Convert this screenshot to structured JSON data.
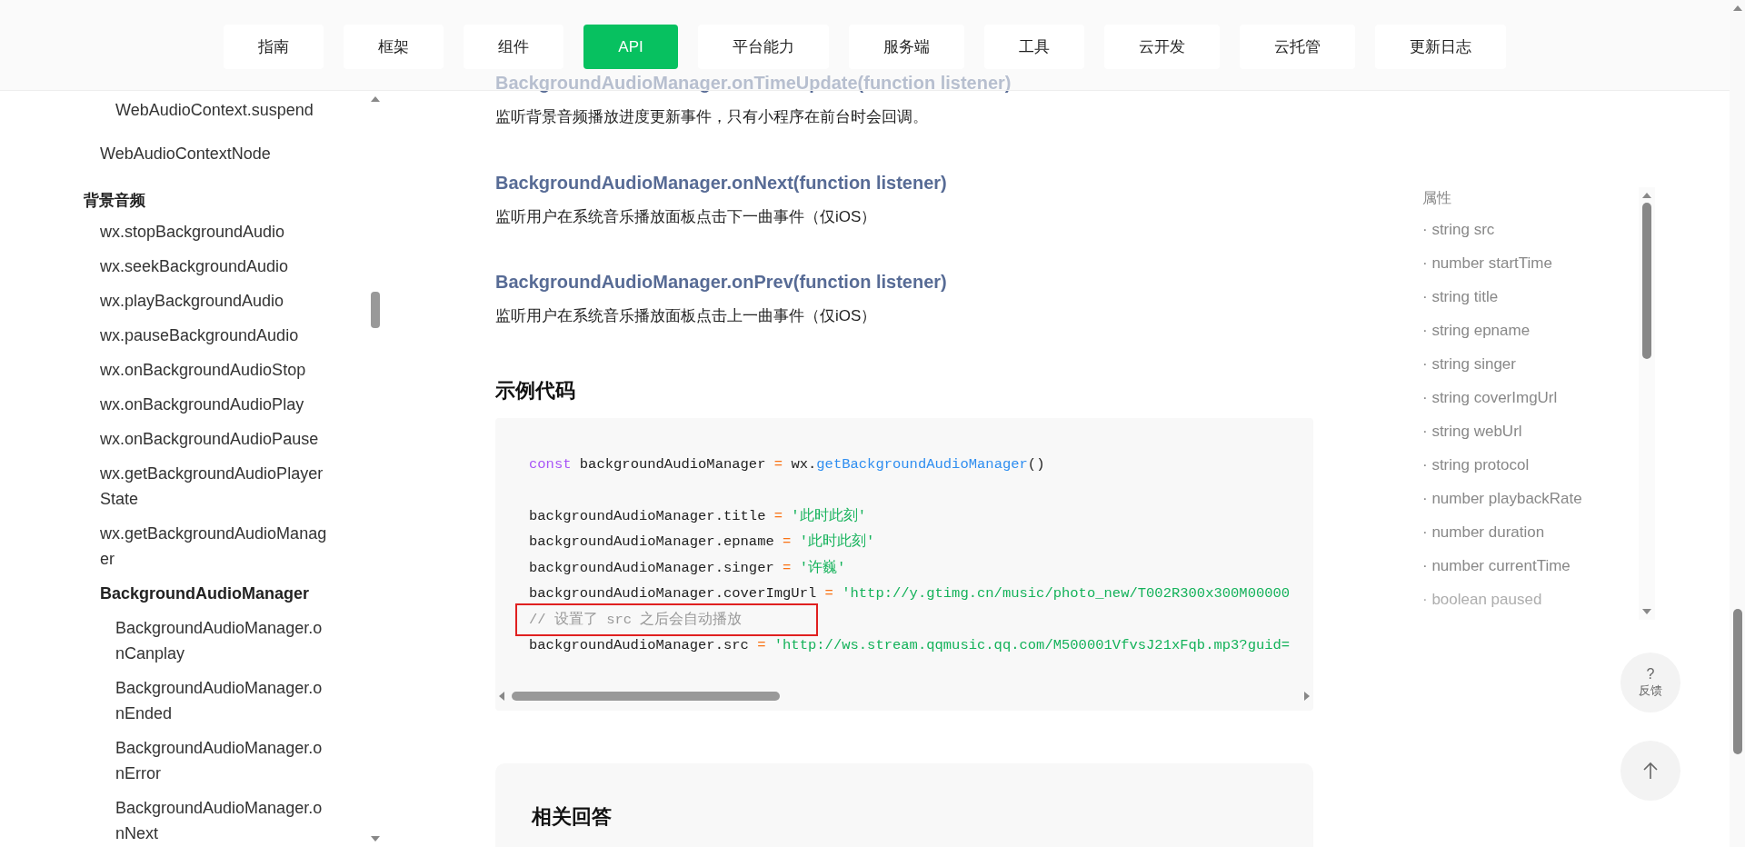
{
  "nav": {
    "tabs": [
      {
        "label": "指南",
        "selected": false
      },
      {
        "label": "框架",
        "selected": false
      },
      {
        "label": "组件",
        "selected": false
      },
      {
        "label": "API",
        "selected": true
      },
      {
        "label": "平台能力",
        "selected": false
      },
      {
        "label": "服务端",
        "selected": false
      },
      {
        "label": "工具",
        "selected": false
      },
      {
        "label": "云开发",
        "selected": false
      },
      {
        "label": "云托管",
        "selected": false
      },
      {
        "label": "更新日志",
        "selected": false
      }
    ]
  },
  "sidebar": {
    "sections": [
      {
        "items": [
          {
            "children": [
              {
                "label": "WebAudioContext.suspend"
              }
            ]
          },
          {
            "label": "WebAudioContextNode"
          }
        ]
      },
      {
        "title": "背景音频",
        "items": [
          {
            "label": "wx.stopBackgroundAudio"
          },
          {
            "label": "wx.seekBackgroundAudio"
          },
          {
            "label": "wx.playBackgroundAudio"
          },
          {
            "label": "wx.pauseBackgroundAudio"
          },
          {
            "label": "wx.onBackgroundAudioStop"
          },
          {
            "label": "wx.onBackgroundAudioPlay"
          },
          {
            "label": "wx.onBackgroundAudioPause"
          },
          {
            "label": "wx.getBackgroundAudioPlayerState"
          },
          {
            "label": "wx.getBackgroundAudioManager"
          },
          {
            "label": "BackgroundAudioManager",
            "children": [
              {
                "label": "BackgroundAudioManager.onCanplay"
              },
              {
                "label": "BackgroundAudioManager.onEnded"
              },
              {
                "label": "BackgroundAudioManager.onError"
              },
              {
                "label": "BackgroundAudioManager.onNext"
              }
            ]
          }
        ]
      }
    ]
  },
  "content": {
    "blocks": [
      {
        "kind": "heading",
        "text": "BackgroundAudioManager.onTimeUpdate(function listener)"
      },
      {
        "kind": "paragraph",
        "text": "监听背景音频播放进度更新事件，只有小程序在前台时会回调。"
      },
      {
        "kind": "heading",
        "text": "BackgroundAudioManager.onNext(function listener)"
      },
      {
        "kind": "paragraph",
        "text": "监听用户在系统音乐播放面板点击下一曲事件（仅iOS）"
      },
      {
        "kind": "heading",
        "text": "BackgroundAudioManager.onPrev(function listener)"
      },
      {
        "kind": "paragraph",
        "text": "监听用户在系统音乐播放面板点击上一曲事件（仅iOS）"
      },
      {
        "kind": "section_title",
        "text": "示例代码"
      }
    ],
    "code": [
      {
        "kind": "code",
        "tokens": [
          {
            "kind": "keyword",
            "text": "const"
          },
          {
            "kind": "plain",
            "text": " backgroundAudioManager "
          },
          {
            "kind": "op",
            "text": "="
          },
          {
            "kind": "plain",
            "text": " wx."
          },
          {
            "kind": "func",
            "text": "getBackgroundAudioManager"
          },
          {
            "kind": "plain",
            "text": "()"
          }
        ]
      },
      {
        "kind": "blank"
      },
      {
        "kind": "code",
        "tokens": [
          {
            "kind": "plain",
            "text": "backgroundAudioManager.title "
          },
          {
            "kind": "op",
            "text": "="
          },
          {
            "kind": "string",
            "text": " '此时此刻'"
          }
        ]
      },
      {
        "kind": "code",
        "tokens": [
          {
            "kind": "plain",
            "text": "backgroundAudioManager.epname "
          },
          {
            "kind": "op",
            "text": "="
          },
          {
            "kind": "string",
            "text": " '此时此刻'"
          }
        ]
      },
      {
        "kind": "code",
        "tokens": [
          {
            "kind": "plain",
            "text": "backgroundAudioManager.singer "
          },
          {
            "kind": "op",
            "text": "="
          },
          {
            "kind": "string",
            "text": " '许巍'"
          }
        ]
      },
      {
        "kind": "code",
        "tokens": [
          {
            "kind": "plain",
            "text": "backgroundAudioManager.coverImgUrl "
          },
          {
            "kind": "op",
            "text": "="
          },
          {
            "kind": "string",
            "text": " 'http://y.gtimg.cn/music/photo_new/T002R300x300M00000"
          }
        ]
      },
      {
        "kind": "code",
        "tokens": [
          {
            "kind": "comment",
            "text": "// 设置了 src 之后会自动播放"
          }
        ]
      },
      {
        "kind": "code",
        "tokens": [
          {
            "kind": "plain",
            "text": "backgroundAudioManager.src "
          },
          {
            "kind": "op",
            "text": "="
          },
          {
            "kind": "string",
            "text": " 'http://ws.stream.qqmusic.qq.com/M500001VfvsJ21xFqb.mp3?guid="
          }
        ]
      }
    ],
    "related_title": "相关回答"
  },
  "toc": {
    "title": "属性",
    "items": [
      {
        "text": "· string src",
        "faded": false
      },
      {
        "text": "· number startTime",
        "faded": false
      },
      {
        "text": "· string title",
        "faded": false
      },
      {
        "text": "· string epname",
        "faded": false
      },
      {
        "text": "· string singer",
        "faded": false
      },
      {
        "text": "· string coverImgUrl",
        "faded": false
      },
      {
        "text": "· string webUrl",
        "faded": false
      },
      {
        "text": "· string protocol",
        "faded": false
      },
      {
        "text": "· number playbackRate",
        "faded": false
      },
      {
        "text": "· number duration",
        "faded": false
      },
      {
        "text": "· number currentTime",
        "faded": false
      },
      {
        "text": "· boolean paused",
        "faded": true
      }
    ]
  },
  "feedback": {
    "mark": "?",
    "label": "反馈"
  }
}
